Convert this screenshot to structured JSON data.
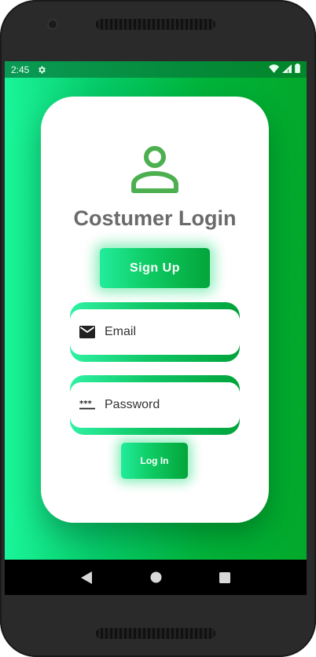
{
  "status_bar": {
    "time": "2:45"
  },
  "card": {
    "title": "Costumer Login",
    "signup_label": "Sign   Up",
    "email_placeholder": "Email",
    "password_placeholder": "Password",
    "login_label": "Log In"
  },
  "colors": {
    "gradient_start": "#1bf59a",
    "gradient_end": "#02a82a",
    "icon_green": "#4caf50",
    "title_gray": "#6a6a6a"
  },
  "icons": {
    "status": [
      "gear-icon",
      "wifi-icon",
      "signal-icon",
      "battery-icon"
    ],
    "user": "user-icon",
    "email": "mail-icon",
    "password": "password-dots-icon",
    "nav": [
      "back-icon",
      "home-icon",
      "recents-icon"
    ]
  }
}
